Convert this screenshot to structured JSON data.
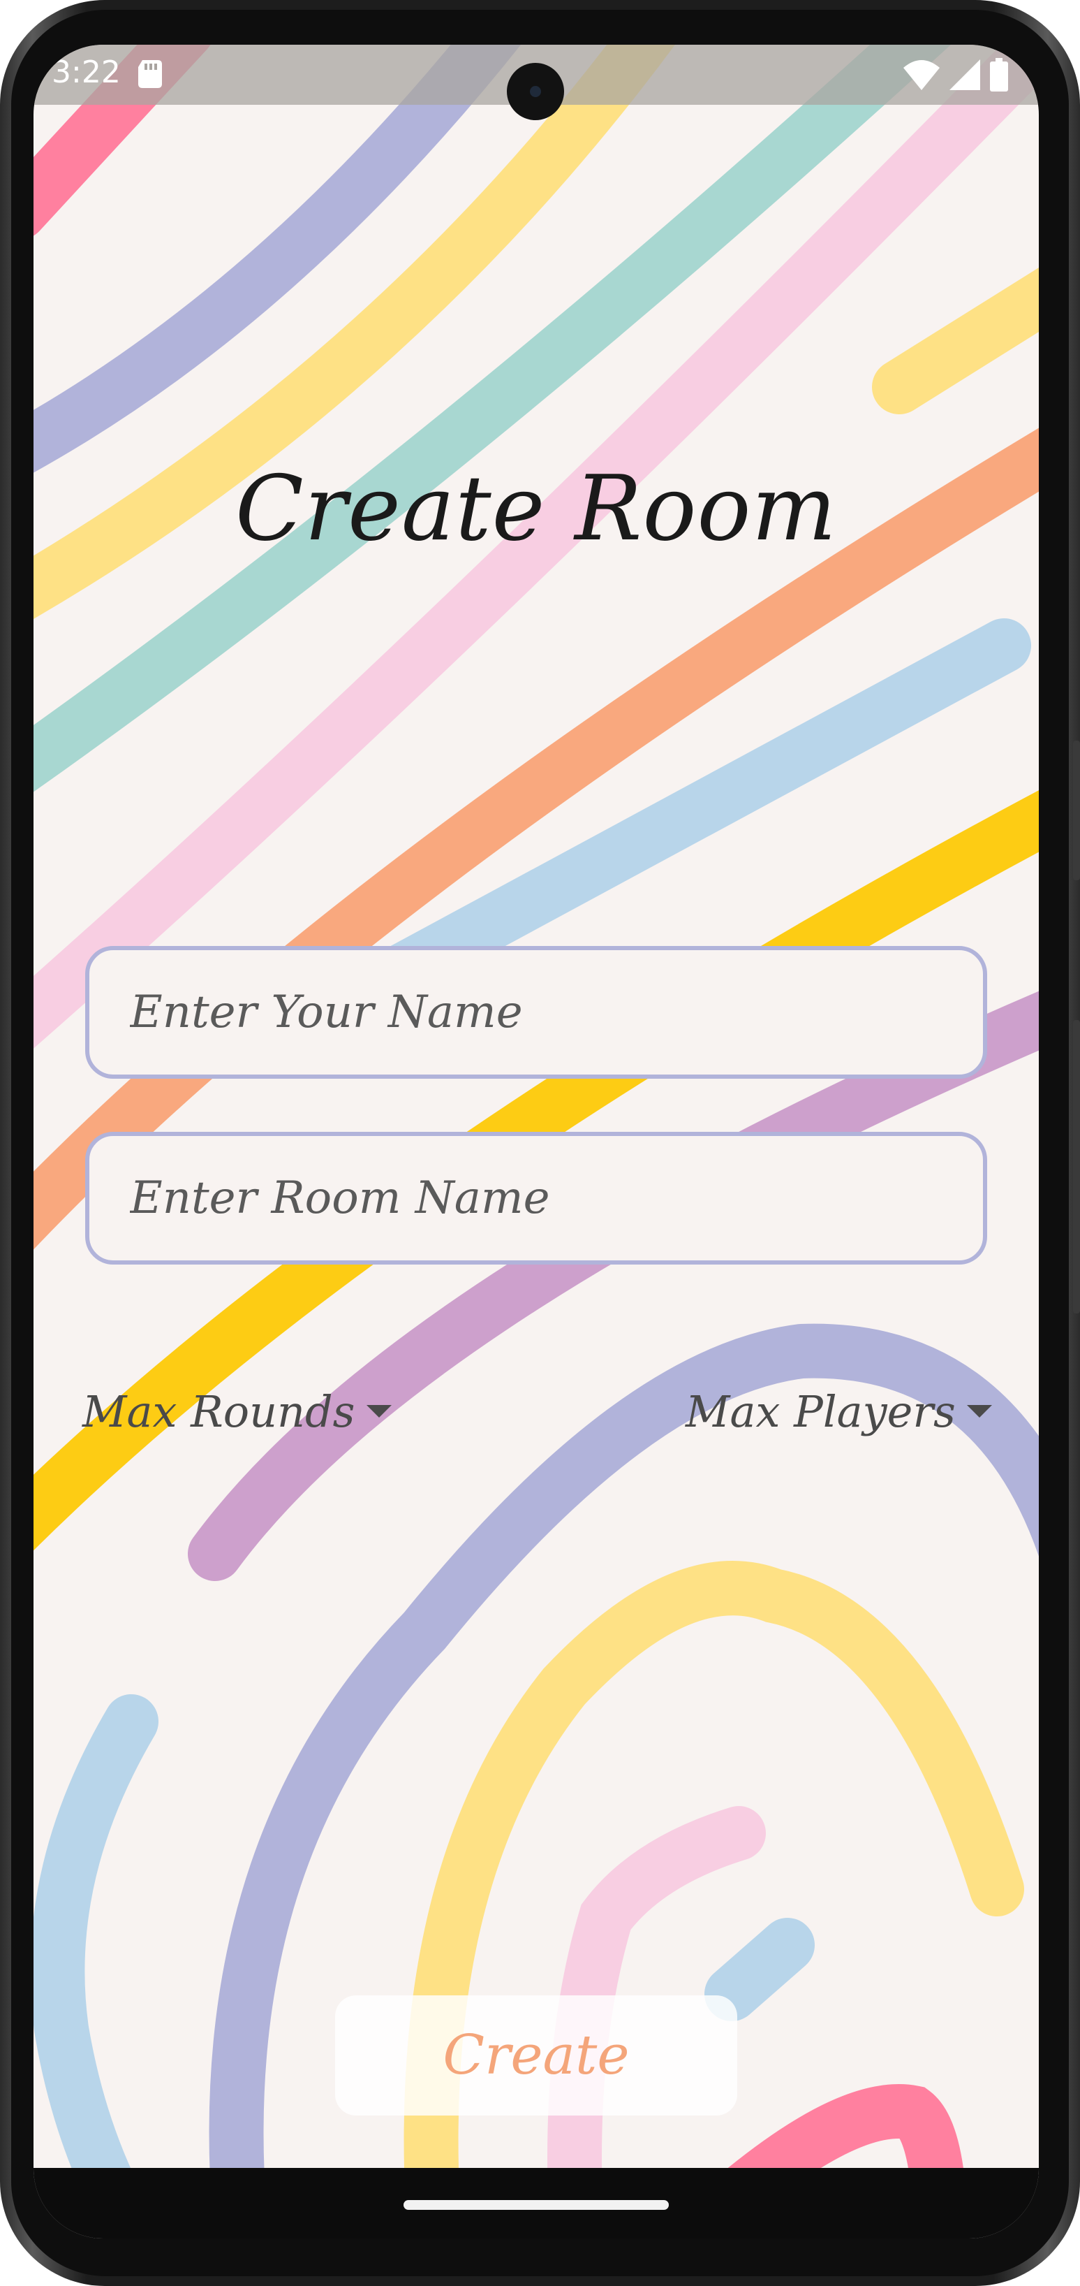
{
  "status_bar": {
    "time": "3:22",
    "icons": [
      "sd-card-icon",
      "wifi-icon",
      "signal-icon",
      "battery-icon"
    ]
  },
  "screen": {
    "title": "Create Room",
    "name_field": {
      "placeholder": "Enter Your Name",
      "value": ""
    },
    "room_field": {
      "placeholder": "Enter Room Name",
      "value": ""
    },
    "max_rounds_label": "Max Rounds",
    "max_players_label": "Max Players",
    "create_label": "Create"
  },
  "colors": {
    "background": "#f8f3f1",
    "field_border": "#b1b3da",
    "create_text": "#f4a57a",
    "title_text": "#1a1a1a",
    "doodle_pink": "#ff809f",
    "doodle_lavender": "#b1b3da",
    "doodle_yellow": "#fee185",
    "doodle_teal": "#a8d7d1",
    "doodle_light_pink": "#f8cee2",
    "doodle_orange": "#f9a87e",
    "doodle_blue": "#b8d5ea",
    "doodle_gold": "#fdcc14",
    "doodle_purple": "#cda0cc"
  }
}
